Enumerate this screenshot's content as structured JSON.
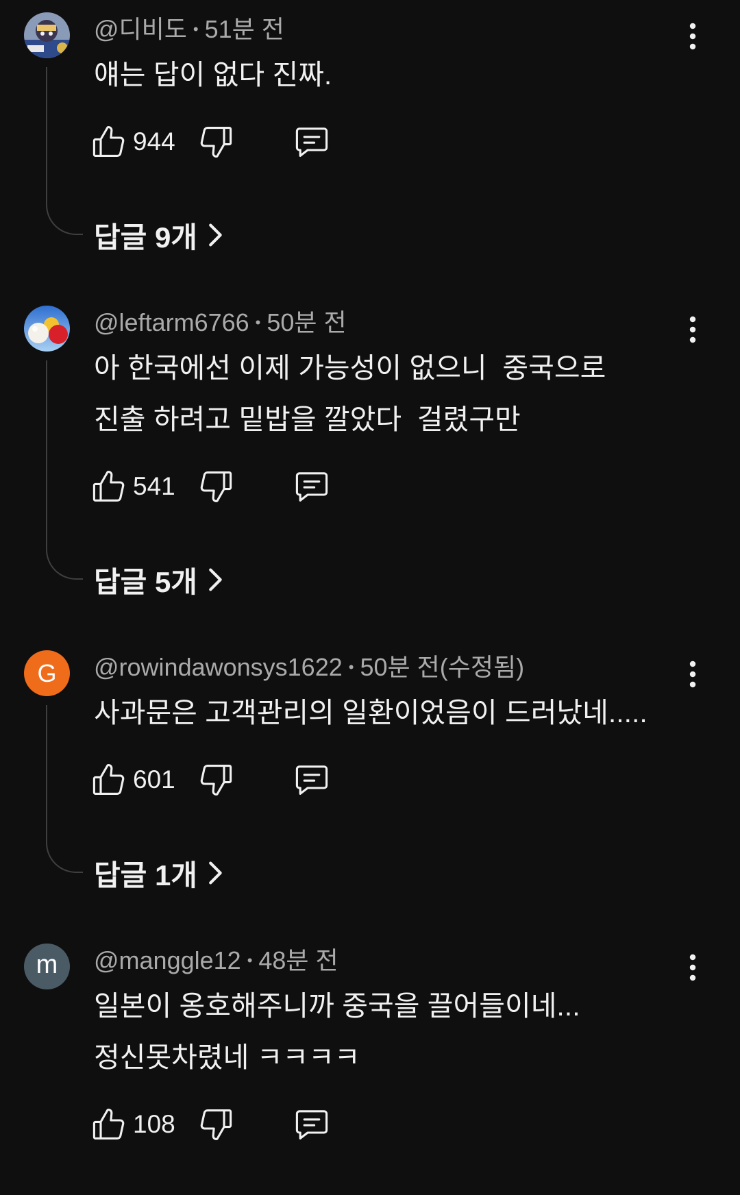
{
  "theme": {
    "background": "#0f0f0f",
    "text_color": "#f1f1f1",
    "meta_color": "#aaaaaa",
    "thread_line_color": "#3f3f3f"
  },
  "icons": {
    "like": "thumbs-up-icon",
    "dislike": "thumbs-down-icon",
    "reply": "comment-icon",
    "menu": "more-vert-icon",
    "expand_replies": "chevron-right-icon"
  },
  "separator": "•",
  "comments": [
    {
      "username": "@디비도",
      "time": "51분 전",
      "text_lines": [
        "얘는 답이 없다 진짜."
      ],
      "likes": "944",
      "replies_label": "답글 9개"
    },
    {
      "username": "@leftarm6766",
      "time": "50분 전",
      "text_lines": [
        "아 한국에선 이제 가능성이 없으니  중국으로",
        "진출 하려고 밑밥을 깔았다  걸렸구만"
      ],
      "likes": "541",
      "replies_label": "답글 5개"
    },
    {
      "username": "@rowindawonsys1622",
      "time": "50분 전(수정됨)",
      "avatar_letter": "G",
      "avatar_color": "#ef6c1a",
      "text_lines": [
        "사과문은 고객관리의 일환이었음이 드러났네....."
      ],
      "likes": "601",
      "replies_label": "답글 1개"
    },
    {
      "username": "@manggle12",
      "time": "48분 전",
      "avatar_letter": "m",
      "avatar_color": "#4b5b65",
      "text_lines": [
        "일본이 옹호해주니까 중국을 끌어들이네...",
        "정신못차렸네 ㅋㅋㅋㅋ"
      ],
      "likes": "108"
    }
  ]
}
